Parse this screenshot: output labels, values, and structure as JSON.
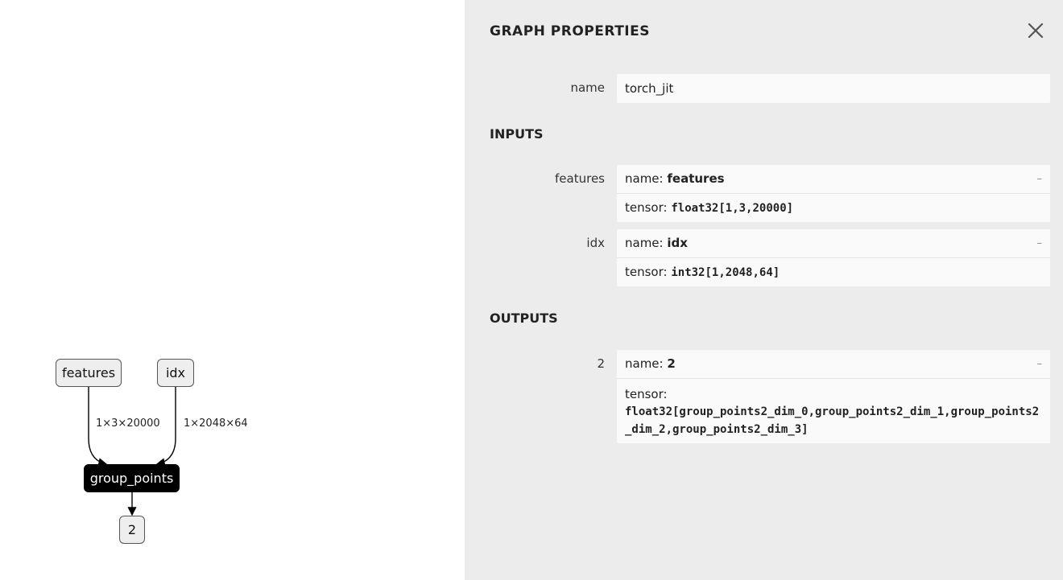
{
  "graph": {
    "nodes": {
      "features": "features",
      "idx": "idx",
      "group_points": "group_points",
      "output": "2"
    },
    "edges": {
      "features_shape": "1×3×20000",
      "idx_shape": "1×2048×64"
    }
  },
  "sidebar": {
    "title": "GRAPH PROPERTIES",
    "name_label": "name",
    "name_value": "torch_jit",
    "inputs_title": "INPUTS",
    "outputs_title": "OUTPUTS",
    "inputs": [
      {
        "label": "features",
        "name_prefix": "name: ",
        "name_value": "features",
        "tensor_prefix": "tensor: ",
        "tensor_value": "float32[1,3,20000]",
        "expander": "–"
      },
      {
        "label": "idx",
        "name_prefix": "name: ",
        "name_value": "idx",
        "tensor_prefix": "tensor: ",
        "tensor_value": "int32[1,2048,64]",
        "expander": "–"
      }
    ],
    "outputs": [
      {
        "label": "2",
        "name_prefix": "name: ",
        "name_value": "2",
        "tensor_prefix": "tensor:",
        "tensor_value": "float32[group_points2_dim_0,group_points2_dim_1,group_points2_dim_2,group_points2_dim_3]",
        "expander": "–"
      }
    ]
  },
  "colors": {
    "sidebar_bg": "#ececec",
    "op_node_bg": "#000000",
    "io_node_bg": "#eeeeee"
  },
  "icons": {
    "close": "close-icon"
  }
}
